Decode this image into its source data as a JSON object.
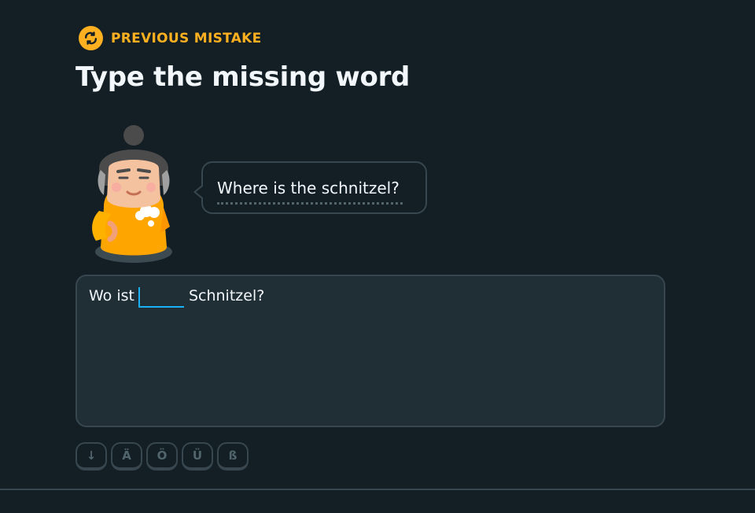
{
  "header": {
    "badge_label": "PREVIOUS MISTAKE",
    "title": "Type the missing word",
    "badge_icon": "repeat-arrows-icon",
    "badge_color": "#ffb020"
  },
  "prompt": {
    "character": "character-avatar",
    "bubble_text": "Where is the schnitzel?"
  },
  "exercise": {
    "before": "Wo ist",
    "after": "Schnitzel?",
    "blank_value": "",
    "accent_color": "#1cb0f6"
  },
  "keyboard": {
    "keys": [
      "↓",
      "Ä",
      "Ö",
      "Ü",
      "ß"
    ]
  }
}
